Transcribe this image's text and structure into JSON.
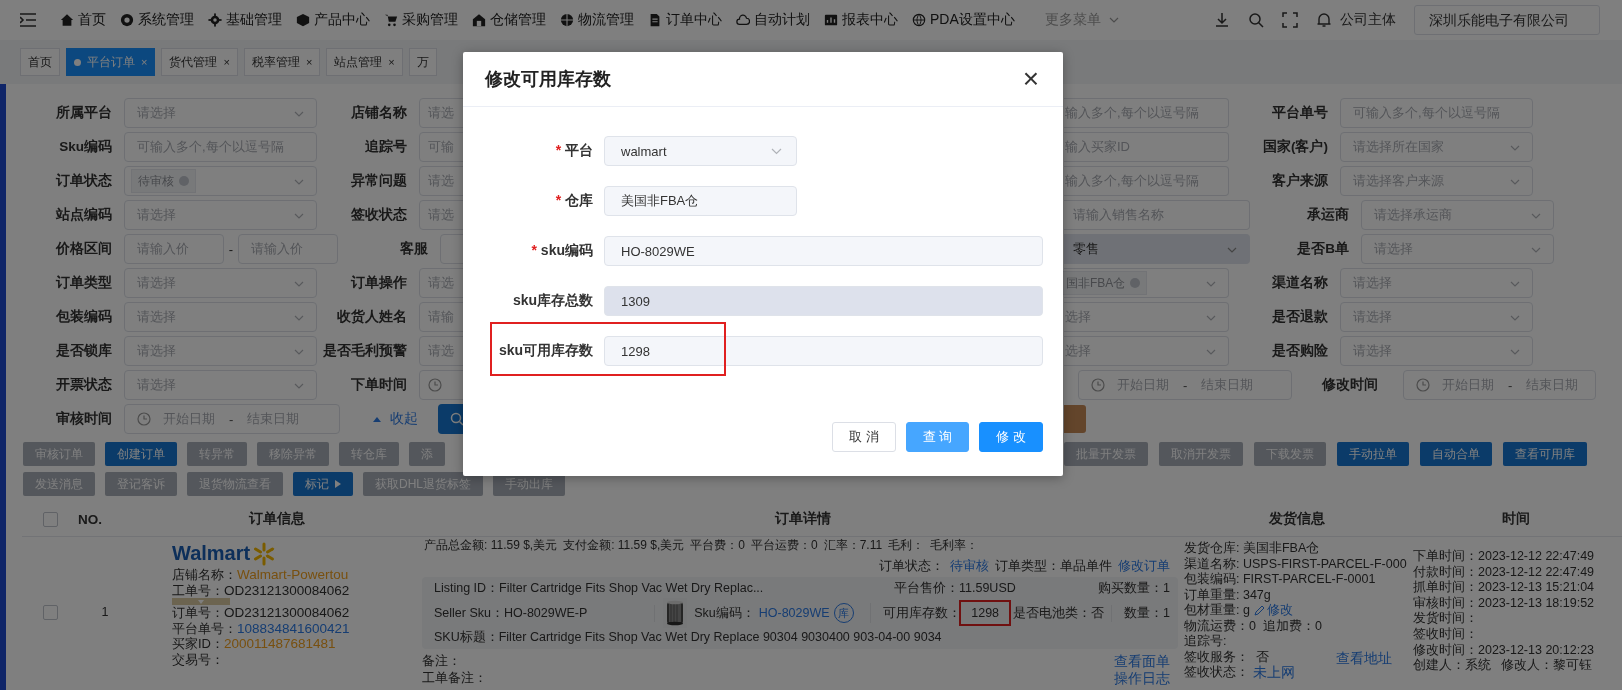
{
  "nav": {
    "items": [
      {
        "label": "首页"
      },
      {
        "label": "系统管理"
      },
      {
        "label": "基础管理"
      },
      {
        "label": "产品中心"
      },
      {
        "label": "采购管理"
      },
      {
        "label": "仓储管理"
      },
      {
        "label": "物流管理"
      },
      {
        "label": "订单中心"
      },
      {
        "label": "自动计划"
      },
      {
        "label": "报表中心"
      },
      {
        "label": "PDA设置中心"
      }
    ],
    "more": "更多菜单",
    "company_label": "公司主体",
    "company": "深圳乐能电子有限公司"
  },
  "tabs": [
    {
      "label": "首页",
      "selected": false
    },
    {
      "label": "平台订单",
      "selected": true,
      "close": "×"
    },
    {
      "label": "货代管理",
      "selected": false,
      "close": "×"
    },
    {
      "label": "税率管理",
      "selected": false,
      "close": "×"
    },
    {
      "label": "站点管理",
      "selected": false,
      "close": "×"
    },
    {
      "label": "万",
      "selected": false
    }
  ],
  "filters": [
    {
      "left": [
        {
          "label": "所属平台",
          "field": {
            "kind": "select",
            "placeholder": "请选择"
          }
        },
        {
          "label": "店铺名称",
          "field": {
            "kind": "input",
            "placeholder": "请选"
          }
        }
      ],
      "right": [
        {
          "field": {
            "kind": "input",
            "placeholder": "输入多个,每个以逗号隔"
          }
        },
        {
          "label": "平台单号",
          "field": {
            "kind": "input",
            "placeholder": "可输入多个,每个以逗号隔"
          }
        }
      ]
    },
    {
      "left": [
        {
          "label": "Sku编码",
          "field": {
            "kind": "input",
            "placeholder": "可输入多个,每个以逗号隔"
          }
        },
        {
          "label": "追踪号",
          "field": {
            "kind": "input",
            "placeholder": "可输"
          }
        }
      ],
      "right": [
        {
          "field": {
            "kind": "input",
            "placeholder": "输入买家ID"
          }
        },
        {
          "label": "国家(客户)",
          "field": {
            "kind": "select",
            "placeholder": "请选择所在国家"
          }
        }
      ]
    },
    {
      "left": [
        {
          "label": "订单状态",
          "field": {
            "kind": "tag",
            "value": "待审核"
          }
        },
        {
          "label": "异常问题",
          "field": {
            "kind": "input",
            "placeholder": "请选"
          }
        }
      ],
      "right": [
        {
          "field": {
            "kind": "input",
            "placeholder": "输入多个,每个以逗号隔"
          }
        },
        {
          "label": "客户来源",
          "field": {
            "kind": "select",
            "placeholder": "请选择客户来源"
          }
        }
      ]
    },
    {
      "left": [
        {
          "label": "站点编码",
          "field": {
            "kind": "select",
            "placeholder": "请选择"
          }
        },
        {
          "label": "签收状态",
          "field": {
            "kind": "input",
            "placeholder": "请选"
          }
        }
      ],
      "right": [
        {
          "field": {
            "kind": "input",
            "placeholder": "请输入销售名称"
          }
        },
        {
          "label": "承运商",
          "field": {
            "kind": "select",
            "placeholder": "请选择承运商"
          }
        }
      ]
    },
    {
      "left": [
        {
          "label": "价格区间",
          "field": {
            "kind": "range",
            "placeholders": [
              "请输入价",
              "请输入价"
            ],
            "separator": "-"
          }
        },
        {
          "label": "客服",
          "field": {
            "kind": "input"
          }
        }
      ],
      "right": [
        {
          "field": {
            "kind": "filled",
            "value": "零售"
          }
        },
        {
          "label": "是否B单",
          "field": {
            "kind": "select",
            "placeholder": "请选择"
          }
        }
      ]
    },
    {
      "left": [
        {
          "label": "订单类型",
          "field": {
            "kind": "select",
            "placeholder": "请选择"
          }
        },
        {
          "label": "订单操作",
          "field": {
            "kind": "input",
            "placeholder": "请选"
          }
        }
      ],
      "right": [
        {
          "field": {
            "kind": "tag",
            "value": "国非FBA仓"
          }
        },
        {
          "label": "渠道名称",
          "field": {
            "kind": "select",
            "placeholder": "请选择"
          }
        }
      ]
    },
    {
      "left": [
        {
          "label": "包装编码",
          "field": {
            "kind": "select",
            "placeholder": "请选择"
          }
        },
        {
          "label": "收货人姓名",
          "field": {
            "kind": "input",
            "placeholder": "请输"
          }
        }
      ],
      "right": [
        {
          "field": {
            "kind": "select",
            "placeholder": "选择"
          }
        },
        {
          "label": "是否退款",
          "field": {
            "kind": "select",
            "placeholder": "请选择"
          }
        }
      ]
    },
    {
      "left": [
        {
          "label": "是否锁库",
          "field": {
            "kind": "select",
            "placeholder": "请选择"
          }
        },
        {
          "label": "是否毛利预警",
          "field": {
            "kind": "input",
            "placeholder": "请选"
          }
        }
      ],
      "right": [
        {
          "field": {
            "kind": "select",
            "placeholder": "选择"
          }
        },
        {
          "label": "是否购险",
          "field": {
            "kind": "select",
            "placeholder": "请选择"
          }
        }
      ]
    },
    {
      "left": [
        {
          "label": "开票状态",
          "field": {
            "kind": "select",
            "placeholder": "请选择"
          }
        },
        {
          "label": "下单时间",
          "field": {
            "kind": "date"
          }
        }
      ],
      "right": [
        {
          "field": {
            "kind": "date",
            "start": "开始日期",
            "separator": "-",
            "end": "结束日期"
          }
        },
        {
          "label": "修改时间",
          "field": {
            "kind": "date",
            "start": "开始日期",
            "separator": "-",
            "end": "结束日期"
          }
        }
      ]
    },
    {
      "left": [
        {
          "label": "审核时间",
          "field": {
            "kind": "date",
            "start": "开始日期",
            "separator": "-",
            "end": "结束日期"
          }
        }
      ],
      "collapse_link": "收起",
      "search_button": true,
      "right_button": true
    }
  ],
  "actions": [
    {
      "left": [
        {
          "label": "审核订单",
          "primary": false
        },
        {
          "label": "创建订单",
          "primary": true
        },
        {
          "label": "转异常",
          "primary": false
        },
        {
          "label": "移除异常",
          "primary": false
        },
        {
          "label": "转仓库",
          "primary": false
        },
        {
          "label": "添",
          "primary": false
        }
      ],
      "right": [
        {
          "label": "批量开发票",
          "primary": false
        },
        {
          "label": "取消开发票",
          "primary": false
        },
        {
          "label": "下载发票",
          "primary": false
        },
        {
          "label": "手动拉单",
          "primary": true
        },
        {
          "label": "自动合单",
          "primary": true
        },
        {
          "label": "查看可用库",
          "primary": true
        }
      ]
    },
    {
      "left": [
        {
          "label": "发送消息",
          "primary": false
        },
        {
          "label": "登记客诉",
          "primary": false
        },
        {
          "label": "退货物流查看",
          "primary": false
        },
        {
          "label": "标记",
          "primary": true,
          "caret": true
        },
        {
          "label": "获取DHL退货标签",
          "primary": false
        },
        {
          "label": "手动出库",
          "primary": false
        }
      ]
    }
  ],
  "table": {
    "select_all": false,
    "columns": [
      "NO.",
      "订单信息",
      "订单详情",
      "发货信息",
      "时间"
    ],
    "rows": [
      {
        "checked": false,
        "no": "1",
        "order": {
          "logo": "Walmart",
          "lines": [
            {
              "label": "店铺名称：",
              "value": "Walmart-Powertou",
              "kind": "accent"
            },
            {
              "label": "工单号：",
              "value": "OD23121300084062",
              "kind": "plain",
              "expand_toggle": true
            },
            {
              "label": "订单号：",
              "value": "OD23121300084062",
              "kind": "plain"
            },
            {
              "label": "平台单号：",
              "value": "108834841600421",
              "kind": "link"
            },
            {
              "label": "买家ID：",
              "value": "200011487681481",
              "kind": "accent"
            },
            {
              "label": "交易号："
            }
          ]
        },
        "detail": {
          "summary": [
            "产品总金额: 11.59 $,美元",
            "支付金额: 11.59 $,美元",
            "平台费：0",
            "平台运费：0",
            "汇率：7.11",
            "毛利：",
            "毛利率："
          ],
          "status_label": "订单状态：",
          "status": "待审核",
          "type": "订单类型：单品单件",
          "edit_link": "修改订单",
          "listing": "Listing ID：Filter Cartridge Fits Shop Vac Wet Dry Replac...",
          "price": "平台售价：11.59USD",
          "buy_qty": "购买数量：1",
          "seller_sku": "Seller Sku：HO-8029WE-P",
          "sku_label": "Sku编码：",
          "sku": "HO-8029WE",
          "stock_badge": "库",
          "stock_label": "可用库存数：",
          "stock": "1298",
          "stock_highlighted": true,
          "battery": "是否电池类：否",
          "qty": "数量：1",
          "sku_title": "SKU标题：Filter Cartridge Fits Shop Vac Wet Dry Replace 90304 9030400 903-04-00 9034",
          "notes": [
            "备注：",
            "工单备注："
          ],
          "links": [
            "查看面单",
            "操作日志"
          ]
        },
        "shipping": {
          "lines": [
            {
              "kind": "text",
              "text": "发货仓库: 美国非FBA仓"
            },
            {
              "kind": "text",
              "text": "渠道名称: USPS-FIRST-PARCEL-F-000"
            },
            {
              "kind": "text",
              "text": "包装编码: FIRST-PARCEL-F-0001"
            },
            {
              "kind": "text",
              "text": "订单重量: 347g"
            },
            {
              "kind": "edit",
              "text": "包材重量: g",
              "link": "修改"
            },
            {
              "kind": "text",
              "text": "物流运费：0  追加费：0"
            },
            {
              "kind": "text",
              "text": "追踪号:"
            },
            {
              "kind": "text",
              "text": "签收服务：  否"
            },
            {
              "kind": "link",
              "text": "签收状态：",
              "link": "未上网"
            }
          ],
          "address_link": "查看地址"
        },
        "times": [
          "下单时间：2023-12-12 22:47:49",
          "付款时间：2023-12-12 22:47:49",
          "抓单时间：2023-12-13 15:21:04",
          "审核时间：2023-12-13 18:19:52",
          "发货时间：",
          "签收时间：",
          "修改时间：2023-12-13 20:12:23",
          "创建人：系统   修改人：黎可钰"
        ]
      }
    ]
  },
  "modal": {
    "title": "修改可用库存数",
    "close": "×",
    "fields": [
      {
        "label": "平台",
        "required_mark": "*",
        "kind": "select",
        "value": "walmart",
        "disabled": false,
        "highlighted": false
      },
      {
        "label": "仓库",
        "required_mark": "*",
        "kind": "input",
        "value": "美国非FBA仓",
        "disabled": false,
        "highlighted": false
      },
      {
        "label": "sku编码",
        "required_mark": "*",
        "kind": "input",
        "value": "HO-8029WE",
        "disabled": false,
        "highlighted": false
      },
      {
        "label": "sku库存总数",
        "kind": "input",
        "value": "1309",
        "disabled": true,
        "highlighted": false
      },
      {
        "label": "sku可用库存数",
        "kind": "input",
        "value": "1298",
        "disabled": false,
        "highlighted": true
      }
    ],
    "buttons": [
      {
        "label": "取 消",
        "kind": "default"
      },
      {
        "label": "查 询",
        "kind": "light"
      },
      {
        "label": "修 改",
        "kind": "primary"
      }
    ]
  }
}
